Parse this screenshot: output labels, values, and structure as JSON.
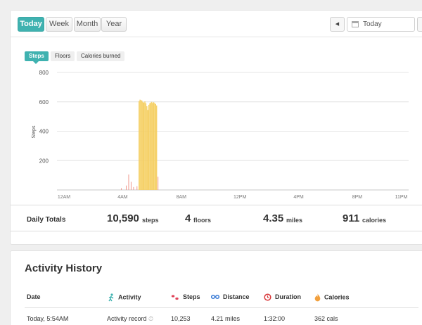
{
  "range_buttons": [
    {
      "label": "Today",
      "active": true
    },
    {
      "label": "Week",
      "active": false
    },
    {
      "label": "Month",
      "active": false
    },
    {
      "label": "Year",
      "active": false
    }
  ],
  "date": {
    "value": "Today"
  },
  "metric_tabs": [
    {
      "label": "Steps",
      "active": true
    },
    {
      "label": "Floors",
      "active": false
    },
    {
      "label": "Calories burned",
      "active": false
    }
  ],
  "colors": {
    "accent": "#3fb2b0",
    "bar_high": "#f5cf62",
    "bar_low": "#f0998e"
  },
  "chart_data": {
    "type": "bar",
    "ylabel": "Steps",
    "ylim": [
      0,
      800
    ],
    "yticks": [
      200,
      400,
      600,
      800
    ],
    "x_ticks": [
      "12AM",
      "4AM",
      "8AM",
      "12PM",
      "4PM",
      "8PM",
      "11PM"
    ],
    "x_unit": "minutes since 12AM",
    "xlim": [
      0,
      1439
    ],
    "grid": true,
    "bars": [
      {
        "minute": 262,
        "steps": 12
      },
      {
        "minute": 282,
        "steps": 30
      },
      {
        "minute": 292,
        "steps": 105
      },
      {
        "minute": 302,
        "steps": 55
      },
      {
        "minute": 312,
        "steps": 20
      },
      {
        "minute": 326,
        "steps": 25
      },
      {
        "minute": 334,
        "steps": 605
      },
      {
        "minute": 338,
        "steps": 615
      },
      {
        "minute": 342,
        "steps": 612
      },
      {
        "minute": 346,
        "steps": 608
      },
      {
        "minute": 350,
        "steps": 598
      },
      {
        "minute": 354,
        "steps": 595
      },
      {
        "minute": 358,
        "steps": 603
      },
      {
        "minute": 362,
        "steps": 590
      },
      {
        "minute": 366,
        "steps": 570
      },
      {
        "minute": 370,
        "steps": 545
      },
      {
        "minute": 374,
        "steps": 580
      },
      {
        "minute": 378,
        "steps": 590
      },
      {
        "minute": 382,
        "steps": 595
      },
      {
        "minute": 386,
        "steps": 600
      },
      {
        "minute": 390,
        "steps": 592
      },
      {
        "minute": 394,
        "steps": 598
      },
      {
        "minute": 398,
        "steps": 592
      },
      {
        "minute": 402,
        "steps": 585
      },
      {
        "minute": 406,
        "steps": 575
      },
      {
        "minute": 412,
        "steps": 90
      }
    ]
  },
  "daily_totals": {
    "label": "Daily Totals",
    "steps": {
      "value": "10,590",
      "unit": "steps"
    },
    "floors": {
      "value": "4",
      "unit": "floors"
    },
    "miles": {
      "value": "4.35",
      "unit": "miles"
    },
    "calories": {
      "value": "911",
      "unit": "calories"
    }
  },
  "activity_history": {
    "title": "Activity History",
    "headers": {
      "date": "Date",
      "activity": "Activity",
      "steps": "Steps",
      "distance": "Distance",
      "duration": "Duration",
      "calories": "Calories"
    },
    "rows": [
      {
        "date": "Today, 5:54AM",
        "activity": "Activity record",
        "steps": "10,253",
        "distance": "4.21 miles",
        "duration": "1:32:00",
        "calories": "362 cals"
      }
    ]
  }
}
